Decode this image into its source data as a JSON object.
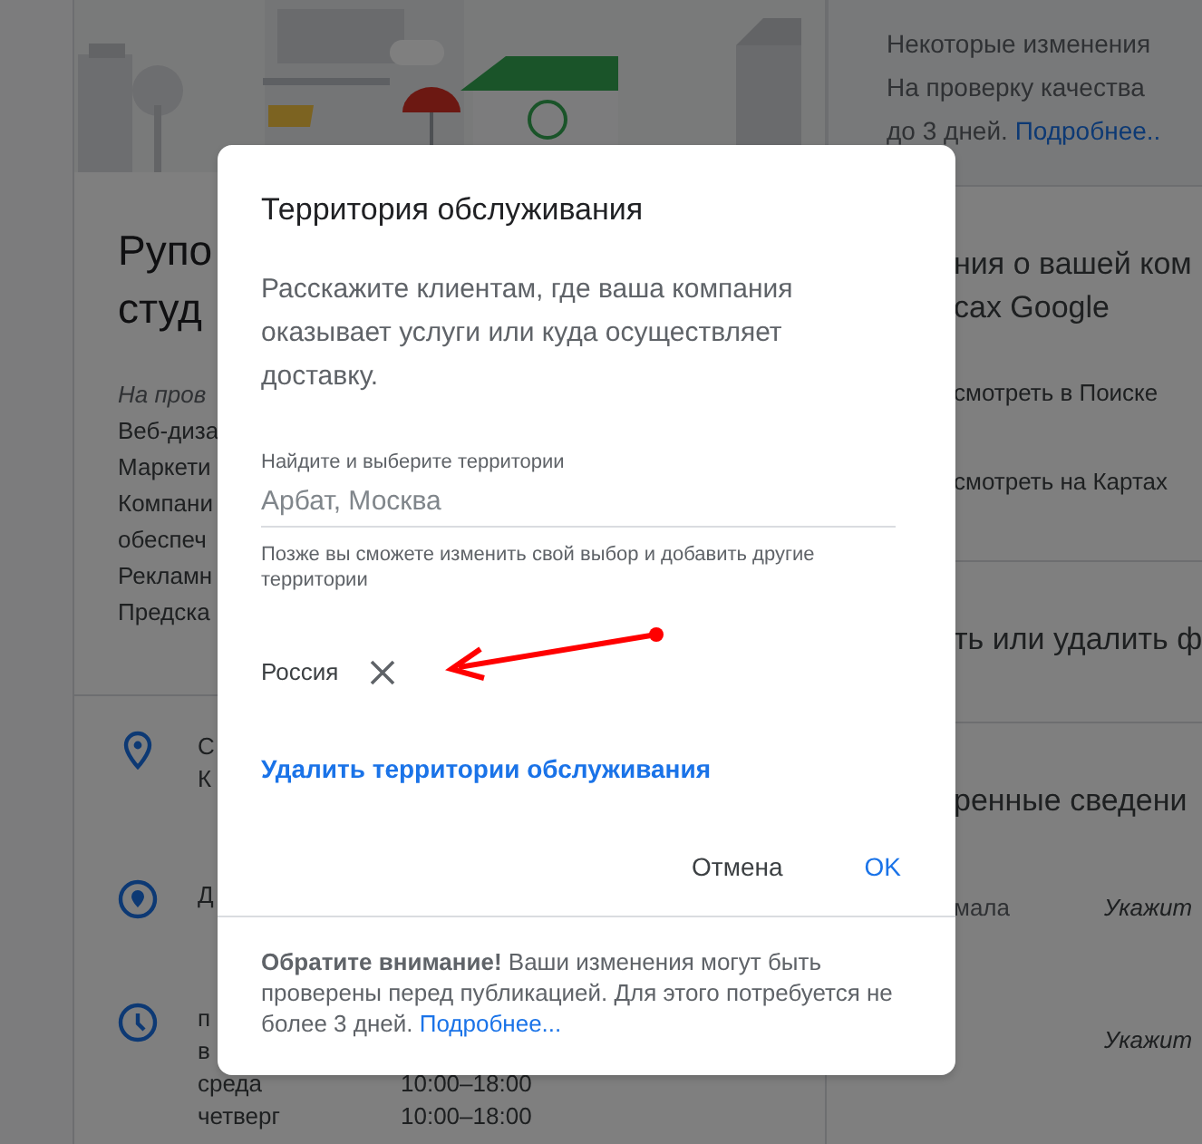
{
  "page": {
    "business": {
      "name_lines": [
        "Рупо",
        "студ"
      ],
      "note": "На пров",
      "categories": [
        "Веб-диза",
        "Маркети",
        "Компани",
        "обеспеч",
        "Рекламн",
        "Предска"
      ]
    },
    "info": [
      {
        "kind": "address",
        "lines": [
          "С",
          "К"
        ]
      },
      {
        "kind": "service_area",
        "lines": [
          "Д"
        ]
      },
      {
        "kind": "hours",
        "rows": [
          {
            "day": "п"
          },
          {
            "day": "в"
          },
          {
            "day": "среда",
            "time": "10:00–18:00"
          },
          {
            "day": "четверг",
            "time": "10:00–18:00"
          }
        ]
      }
    ],
    "notice": {
      "lines": [
        "Некоторые изменения",
        "На проверку качества"
      ],
      "last_line": "до 3 дней.",
      "link": "Подробнее.."
    },
    "sections": [
      {
        "title_lines": [
          "ния о вашей ком",
          "сах Google"
        ],
        "links": [
          "смотреть в Поиске",
          "смотреть на Картах"
        ]
      },
      {
        "title_lines": [
          "ть или удалить ф"
        ]
      },
      {
        "title_lines": [
          "ренные сведени"
        ],
        "fields": [
          {
            "label": "мала",
            "value": "Укажит"
          },
          {
            "value": "Укажит"
          }
        ]
      }
    ]
  },
  "dialog": {
    "title": "Территория обслуживания",
    "description": "Расскажите клиентам, где ваша компания оказывает услуги или куда осуществляет доставку.",
    "search": {
      "label": "Найдите и выберите территории",
      "placeholder": "Арбат, Москва",
      "helper": "Позже вы сможете изменить свой выбор и добавить другие территории"
    },
    "chips": [
      {
        "label": "Россия"
      }
    ],
    "remove_link": "Удалить территории обслуживания",
    "buttons": [
      {
        "label": "Отмена",
        "kind": "text"
      },
      {
        "label": "OK",
        "kind": "primary"
      }
    ],
    "footer": {
      "text": "**Обратите внимание!** Ваши изменения могут быть проверены перед публикацией. Для этого потребуется не более 3 дней.",
      "link": "Подробнее..."
    }
  }
}
